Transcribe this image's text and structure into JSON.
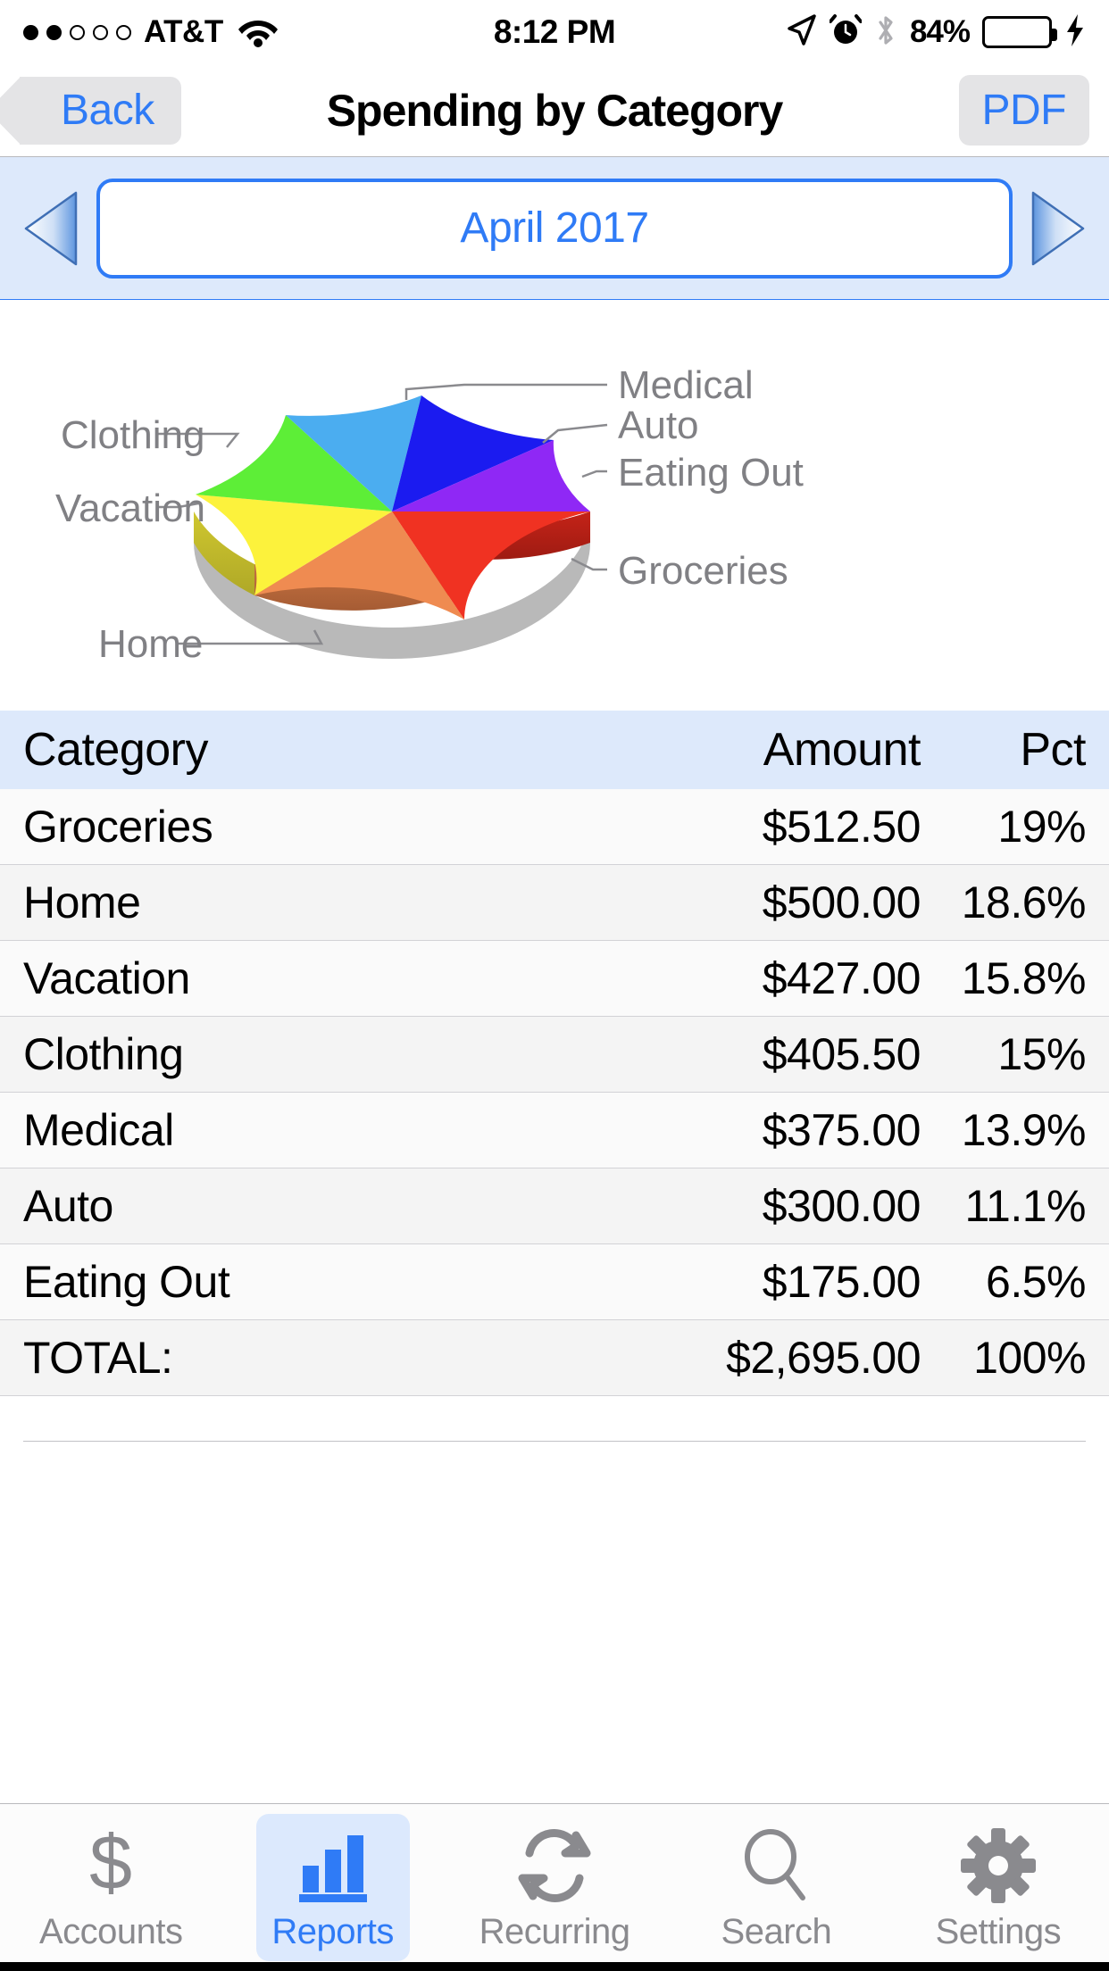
{
  "status_bar": {
    "signal_dots_filled": 2,
    "signal_dots_total": 5,
    "carrier": "AT&T",
    "wifi_icon": "wifi-icon",
    "time": "8:12 PM",
    "location_icon": "location-arrow-icon",
    "alarm_icon": "alarm-clock-icon",
    "bluetooth_icon": "bluetooth-icon",
    "battery_percent": "84%",
    "charging_icon": "lightning-bolt-icon",
    "battery_fill_color": "#76E383"
  },
  "nav_bar": {
    "back_label": "Back",
    "title": "Spending by Category",
    "pdf_label": "PDF",
    "tint_color": "#2f7bf6"
  },
  "month_selector": {
    "prev_icon": "chevron-left-triangle-icon",
    "next_icon": "chevron-right-triangle-icon",
    "value": "April 2017",
    "border_color": "#2f7bf6",
    "bar_background": "#DDE9FB"
  },
  "table": {
    "columns": [
      "Category",
      "Amount",
      "Pct"
    ],
    "rows": [
      {
        "category": "Groceries",
        "amount": "$512.50",
        "pct": "19%"
      },
      {
        "category": "Home",
        "amount": "$500.00",
        "pct": "18.6%"
      },
      {
        "category": "Vacation",
        "amount": "$427.00",
        "pct": "15.8%"
      },
      {
        "category": "Clothing",
        "amount": "$405.50",
        "pct": "15%"
      },
      {
        "category": "Medical",
        "amount": "$375.00",
        "pct": "13.9%"
      },
      {
        "category": "Auto",
        "amount": "$300.00",
        "pct": "11.1%"
      },
      {
        "category": "Eating Out",
        "amount": "$175.00",
        "pct": "6.5%"
      }
    ],
    "total": {
      "category": "TOTAL:",
      "amount": "$2,695.00",
      "pct": "100%"
    }
  },
  "tab_bar": {
    "items": [
      {
        "label": "Accounts",
        "icon": "dollar-sign-icon",
        "active": false
      },
      {
        "label": "Reports",
        "icon": "bar-chart-icon",
        "active": true
      },
      {
        "label": "Recurring",
        "icon": "refresh-cycle-icon",
        "active": false
      },
      {
        "label": "Search",
        "icon": "magnifier-icon",
        "active": false
      },
      {
        "label": "Settings",
        "icon": "gear-icon",
        "active": false
      }
    ],
    "active_color": "#2f7bf6",
    "inactive_color": "#8a8a8e",
    "active_pill_color": "#DCE9FD"
  },
  "chart_data": {
    "type": "pie",
    "title": "Spending by Category",
    "three_d": true,
    "categories": [
      "Groceries",
      "Home",
      "Vacation",
      "Clothing",
      "Medical",
      "Auto",
      "Eating Out"
    ],
    "values": [
      512.5,
      500.0,
      427.0,
      405.5,
      375.0,
      300.0,
      175.0
    ],
    "percents": [
      19,
      18.6,
      15.8,
      15,
      13.9,
      11.1,
      6.5
    ],
    "total": 2695.0,
    "colors": [
      "#F03222",
      "#EF8B51",
      "#FCF23C",
      "#5DEE37",
      "#4BADF0",
      "#1B1BF0",
      "#8F28F5"
    ],
    "labels": [
      "Groceries",
      "Home",
      "Vacation",
      "Clothing",
      "Medical",
      "Auto",
      "Eating Out"
    ],
    "legend_position": "callout-leader-lines",
    "label_color": "#808084"
  }
}
